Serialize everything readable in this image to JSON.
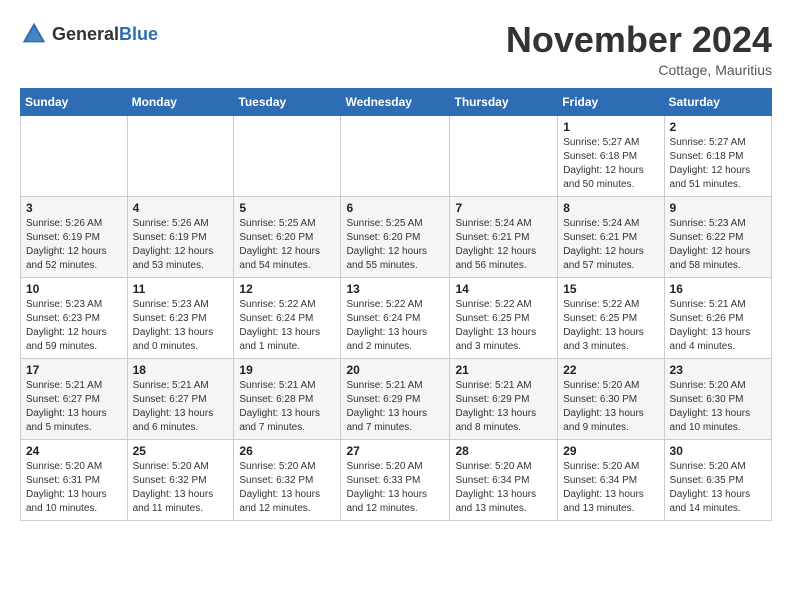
{
  "header": {
    "logo_general": "General",
    "logo_blue": "Blue",
    "month_title": "November 2024",
    "location": "Cottage, Mauritius"
  },
  "calendar": {
    "days_of_week": [
      "Sunday",
      "Monday",
      "Tuesday",
      "Wednesday",
      "Thursday",
      "Friday",
      "Saturday"
    ],
    "weeks": [
      [
        {
          "day": "",
          "info": ""
        },
        {
          "day": "",
          "info": ""
        },
        {
          "day": "",
          "info": ""
        },
        {
          "day": "",
          "info": ""
        },
        {
          "day": "",
          "info": ""
        },
        {
          "day": "1",
          "info": "Sunrise: 5:27 AM\nSunset: 6:18 PM\nDaylight: 12 hours\nand 50 minutes."
        },
        {
          "day": "2",
          "info": "Sunrise: 5:27 AM\nSunset: 6:18 PM\nDaylight: 12 hours\nand 51 minutes."
        }
      ],
      [
        {
          "day": "3",
          "info": "Sunrise: 5:26 AM\nSunset: 6:19 PM\nDaylight: 12 hours\nand 52 minutes."
        },
        {
          "day": "4",
          "info": "Sunrise: 5:26 AM\nSunset: 6:19 PM\nDaylight: 12 hours\nand 53 minutes."
        },
        {
          "day": "5",
          "info": "Sunrise: 5:25 AM\nSunset: 6:20 PM\nDaylight: 12 hours\nand 54 minutes."
        },
        {
          "day": "6",
          "info": "Sunrise: 5:25 AM\nSunset: 6:20 PM\nDaylight: 12 hours\nand 55 minutes."
        },
        {
          "day": "7",
          "info": "Sunrise: 5:24 AM\nSunset: 6:21 PM\nDaylight: 12 hours\nand 56 minutes."
        },
        {
          "day": "8",
          "info": "Sunrise: 5:24 AM\nSunset: 6:21 PM\nDaylight: 12 hours\nand 57 minutes."
        },
        {
          "day": "9",
          "info": "Sunrise: 5:23 AM\nSunset: 6:22 PM\nDaylight: 12 hours\nand 58 minutes."
        }
      ],
      [
        {
          "day": "10",
          "info": "Sunrise: 5:23 AM\nSunset: 6:23 PM\nDaylight: 12 hours\nand 59 minutes."
        },
        {
          "day": "11",
          "info": "Sunrise: 5:23 AM\nSunset: 6:23 PM\nDaylight: 13 hours\nand 0 minutes."
        },
        {
          "day": "12",
          "info": "Sunrise: 5:22 AM\nSunset: 6:24 PM\nDaylight: 13 hours\nand 1 minute."
        },
        {
          "day": "13",
          "info": "Sunrise: 5:22 AM\nSunset: 6:24 PM\nDaylight: 13 hours\nand 2 minutes."
        },
        {
          "day": "14",
          "info": "Sunrise: 5:22 AM\nSunset: 6:25 PM\nDaylight: 13 hours\nand 3 minutes."
        },
        {
          "day": "15",
          "info": "Sunrise: 5:22 AM\nSunset: 6:25 PM\nDaylight: 13 hours\nand 3 minutes."
        },
        {
          "day": "16",
          "info": "Sunrise: 5:21 AM\nSunset: 6:26 PM\nDaylight: 13 hours\nand 4 minutes."
        }
      ],
      [
        {
          "day": "17",
          "info": "Sunrise: 5:21 AM\nSunset: 6:27 PM\nDaylight: 13 hours\nand 5 minutes."
        },
        {
          "day": "18",
          "info": "Sunrise: 5:21 AM\nSunset: 6:27 PM\nDaylight: 13 hours\nand 6 minutes."
        },
        {
          "day": "19",
          "info": "Sunrise: 5:21 AM\nSunset: 6:28 PM\nDaylight: 13 hours\nand 7 minutes."
        },
        {
          "day": "20",
          "info": "Sunrise: 5:21 AM\nSunset: 6:29 PM\nDaylight: 13 hours\nand 7 minutes."
        },
        {
          "day": "21",
          "info": "Sunrise: 5:21 AM\nSunset: 6:29 PM\nDaylight: 13 hours\nand 8 minutes."
        },
        {
          "day": "22",
          "info": "Sunrise: 5:20 AM\nSunset: 6:30 PM\nDaylight: 13 hours\nand 9 minutes."
        },
        {
          "day": "23",
          "info": "Sunrise: 5:20 AM\nSunset: 6:30 PM\nDaylight: 13 hours\nand 10 minutes."
        }
      ],
      [
        {
          "day": "24",
          "info": "Sunrise: 5:20 AM\nSunset: 6:31 PM\nDaylight: 13 hours\nand 10 minutes."
        },
        {
          "day": "25",
          "info": "Sunrise: 5:20 AM\nSunset: 6:32 PM\nDaylight: 13 hours\nand 11 minutes."
        },
        {
          "day": "26",
          "info": "Sunrise: 5:20 AM\nSunset: 6:32 PM\nDaylight: 13 hours\nand 12 minutes."
        },
        {
          "day": "27",
          "info": "Sunrise: 5:20 AM\nSunset: 6:33 PM\nDaylight: 13 hours\nand 12 minutes."
        },
        {
          "day": "28",
          "info": "Sunrise: 5:20 AM\nSunset: 6:34 PM\nDaylight: 13 hours\nand 13 minutes."
        },
        {
          "day": "29",
          "info": "Sunrise: 5:20 AM\nSunset: 6:34 PM\nDaylight: 13 hours\nand 13 minutes."
        },
        {
          "day": "30",
          "info": "Sunrise: 5:20 AM\nSunset: 6:35 PM\nDaylight: 13 hours\nand 14 minutes."
        }
      ]
    ]
  }
}
